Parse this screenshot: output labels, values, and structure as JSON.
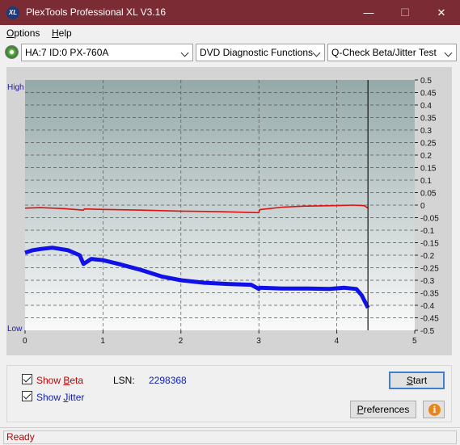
{
  "window": {
    "title": "PlexTools Professional XL V3.16",
    "icon_label": "XL"
  },
  "menu": [
    {
      "label": "Options",
      "ul": "O",
      "rest": "ptions"
    },
    {
      "label": "Help",
      "ul": "H",
      "rest": "elp"
    }
  ],
  "toolbar": {
    "drive": "HA:7 ID:0  PX-760A",
    "function": "DVD Diagnostic Functions",
    "test": "Q-Check Beta/Jitter Test"
  },
  "chart_data": {
    "type": "line",
    "x_ticks": [
      "0",
      "1",
      "2",
      "3",
      "4",
      "5"
    ],
    "xlim": [
      0,
      5
    ],
    "left_labels": {
      "top": "High",
      "bottom": "Low"
    },
    "y_right_ticks": [
      "0.5",
      "0.45",
      "0.4",
      "0.35",
      "0.3",
      "0.25",
      "0.2",
      "0.15",
      "0.1",
      "0.05",
      "0",
      "-0.05",
      "-0.1",
      "-0.15",
      "-0.2",
      "-0.25",
      "-0.3",
      "-0.35",
      "-0.4",
      "-0.45",
      "-0.5"
    ],
    "ylim": [
      -0.5,
      0.5
    ],
    "end_marker_x": 4.4,
    "series": [
      {
        "color": "#e01010",
        "x": [
          0,
          0.2,
          0.5,
          0.75,
          0.76,
          1.0,
          1.5,
          2.0,
          2.5,
          3.0,
          3.01,
          3.3,
          3.6,
          4.0,
          4.2,
          4.35,
          4.4
        ],
        "y": [
          -0.012,
          -0.01,
          -0.014,
          -0.02,
          -0.015,
          -0.017,
          -0.02,
          -0.024,
          -0.026,
          -0.03,
          -0.018,
          -0.008,
          -0.004,
          -0.002,
          0.0,
          -0.002,
          -0.012
        ]
      },
      {
        "color": "#1010e8",
        "x": [
          0,
          0.1,
          0.2,
          0.35,
          0.55,
          0.7,
          0.75,
          0.85,
          1.0,
          1.2,
          1.5,
          1.75,
          2.0,
          2.3,
          2.6,
          2.9,
          3.0,
          3.01,
          3.3,
          3.6,
          3.9,
          4.1,
          4.25,
          4.32,
          4.4
        ],
        "y": [
          -0.19,
          -0.18,
          -0.175,
          -0.17,
          -0.18,
          -0.2,
          -0.235,
          -0.215,
          -0.22,
          -0.235,
          -0.26,
          -0.285,
          -0.3,
          -0.31,
          -0.315,
          -0.318,
          -0.335,
          -0.33,
          -0.333,
          -0.333,
          -0.335,
          -0.33,
          -0.335,
          -0.36,
          -0.41
        ]
      }
    ]
  },
  "bottom": {
    "show_beta": {
      "label": "Show Beta",
      "pre": "Show ",
      "ul": "B",
      "post": "eta",
      "checked": true
    },
    "show_jitter": {
      "label": "Show Jitter",
      "pre": "Show ",
      "ul": "J",
      "post": "itter",
      "checked": true
    },
    "lsn_label": "LSN:",
    "lsn_value": "2298368",
    "start": {
      "label": "Start",
      "ul": "S",
      "rest": "tart"
    },
    "preferences": {
      "label": "Preferences",
      "ul": "P",
      "rest": "references"
    },
    "info_icon": "info-icon"
  },
  "status": "Ready"
}
